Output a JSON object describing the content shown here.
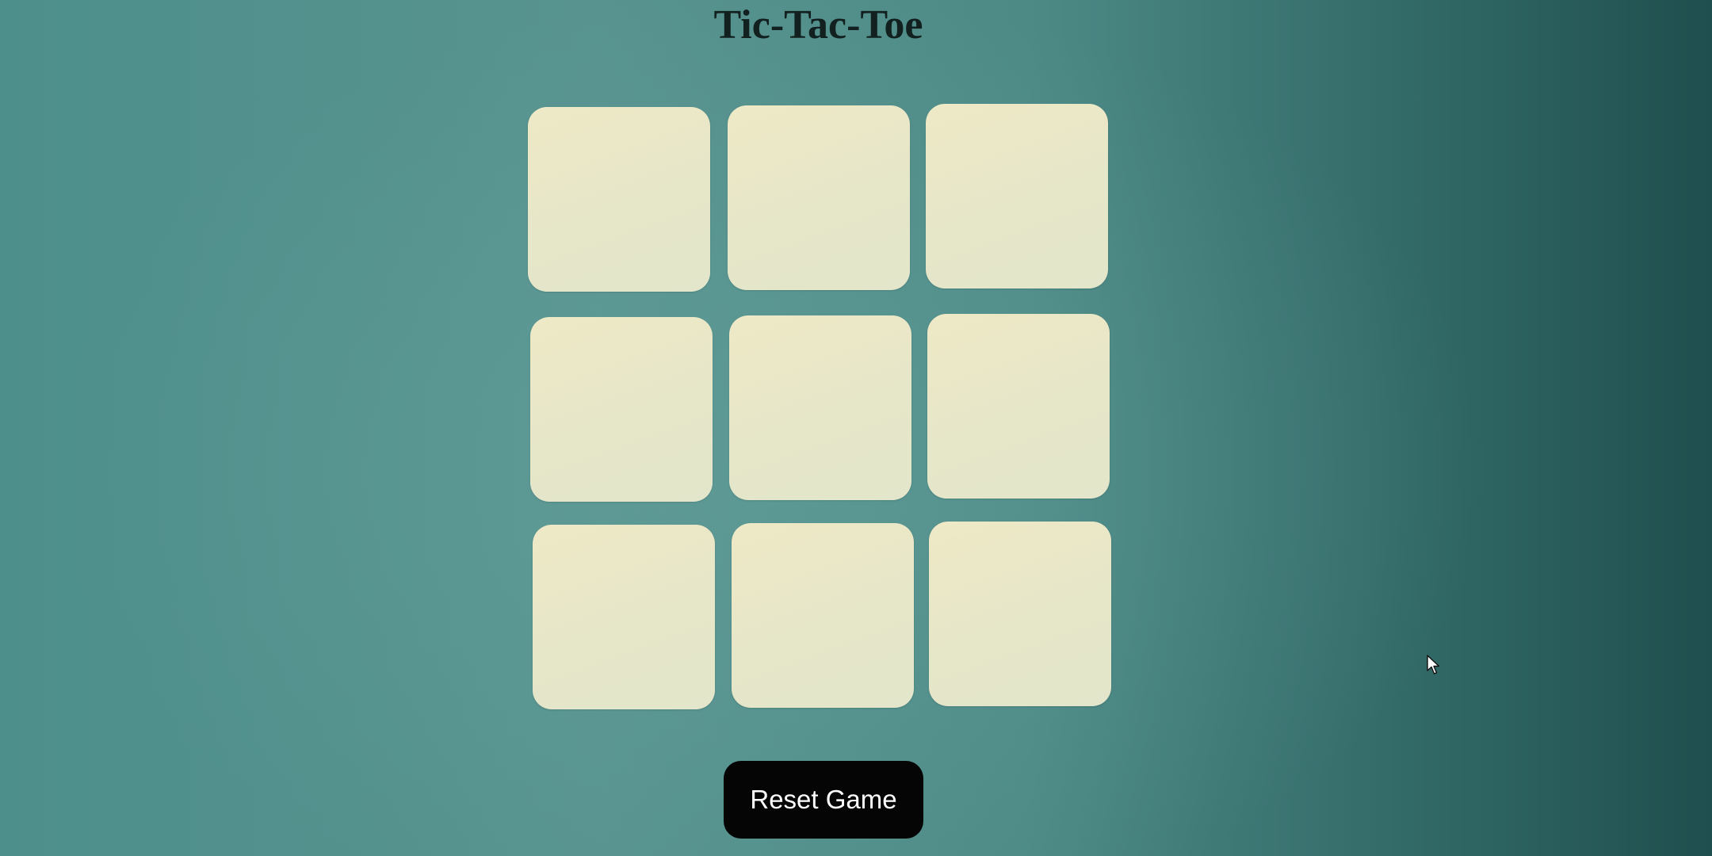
{
  "page": {
    "title": "Tic-Tac-Toe"
  },
  "board": {
    "cells": [
      "",
      "",
      "",
      "",
      "",
      "",
      "",
      "",
      ""
    ]
  },
  "controls": {
    "reset_label": "Reset Game"
  },
  "colors": {
    "background": "#4f8f8b",
    "cell": "#eae6c4",
    "button": "#050505",
    "button_text": "#ffffff",
    "title": "#12211f"
  },
  "icons": {
    "cursor": "mouse-pointer-icon"
  }
}
